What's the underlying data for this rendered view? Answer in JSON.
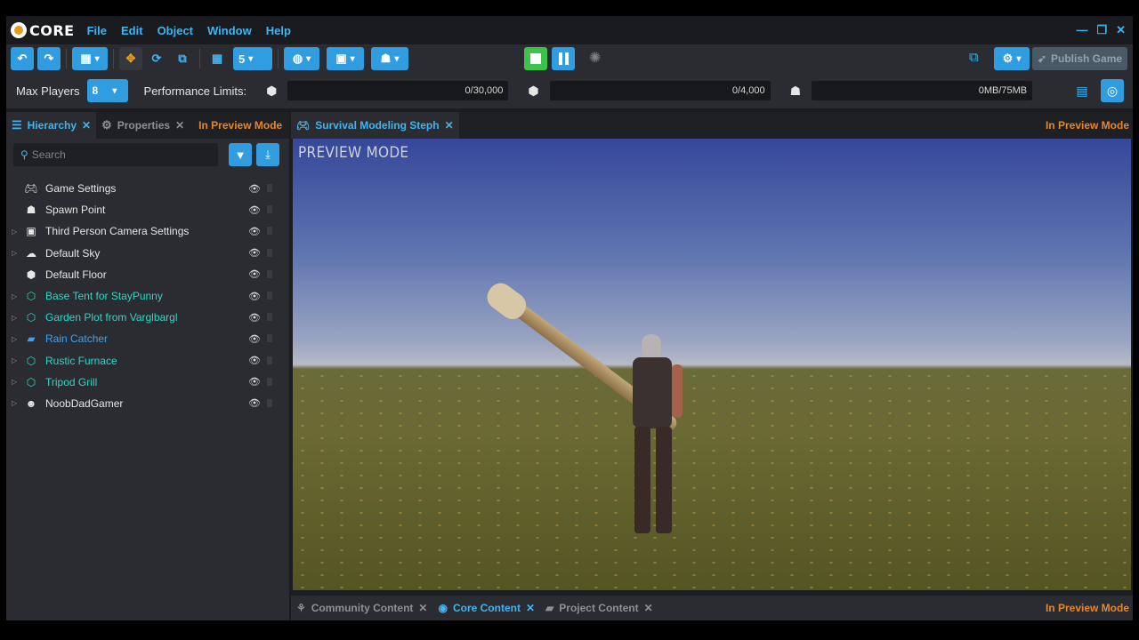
{
  "app": {
    "logo_text": "CORE"
  },
  "menu": [
    "File",
    "Edit",
    "Object",
    "Window",
    "Help"
  ],
  "window_controls": {
    "minimize": "—",
    "restore": "❐",
    "close": "✕"
  },
  "toolbar": {
    "undo": "↶",
    "redo": "↷",
    "grid_value": "5",
    "publish_label": "Publish Game"
  },
  "perf": {
    "max_players_label": "Max Players",
    "max_players_value": "8",
    "limits_label": "Performance Limits:",
    "objects": "0/30,000",
    "networked": "0/4,000",
    "memory": "0MB/75MB"
  },
  "left_tabs": {
    "hierarchy": "Hierarchy",
    "properties": "Properties",
    "mode": "In Preview Mode"
  },
  "search": {
    "placeholder": "Search"
  },
  "hierarchy": [
    {
      "label": "Game Settings",
      "icon": "gamepad-icon",
      "expand": false,
      "color": "white"
    },
    {
      "label": "Spawn Point",
      "icon": "spawn-icon",
      "expand": false,
      "color": "white"
    },
    {
      "label": "Third Person Camera Settings",
      "icon": "camera-icon",
      "expand": true,
      "color": "white"
    },
    {
      "label": "Default Sky",
      "icon": "sky-icon",
      "expand": true,
      "color": "white"
    },
    {
      "label": "Default Floor",
      "icon": "cube-icon",
      "expand": false,
      "color": "white"
    },
    {
      "label": "Base Tent for StayPunny",
      "icon": "template-icon",
      "expand": true,
      "color": "teal"
    },
    {
      "label": "Garden Plot from Varglbargl",
      "icon": "template-icon",
      "expand": true,
      "color": "teal"
    },
    {
      "label": "Rain Catcher",
      "icon": "folder-icon",
      "expand": true,
      "color": "blue"
    },
    {
      "label": "Rustic Furnace",
      "icon": "template-icon",
      "expand": true,
      "color": "teal"
    },
    {
      "label": "Tripod Grill",
      "icon": "template-icon",
      "expand": true,
      "color": "teal"
    },
    {
      "label": "NoobDadGamer",
      "icon": "player-icon",
      "expand": true,
      "color": "white"
    }
  ],
  "viewport": {
    "tab_label": "Survival Modeling Steph",
    "mode": "In Preview Mode",
    "overlay": "PREVIEW MODE"
  },
  "bottom_tabs": {
    "community": "Community Content",
    "core": "Core Content",
    "project": "Project Content",
    "mode": "In Preview Mode"
  },
  "colors": {
    "accent": "#2f9de0",
    "teal": "#2fd7c3",
    "orange": "#e6862a",
    "play": "#3cc34a"
  }
}
